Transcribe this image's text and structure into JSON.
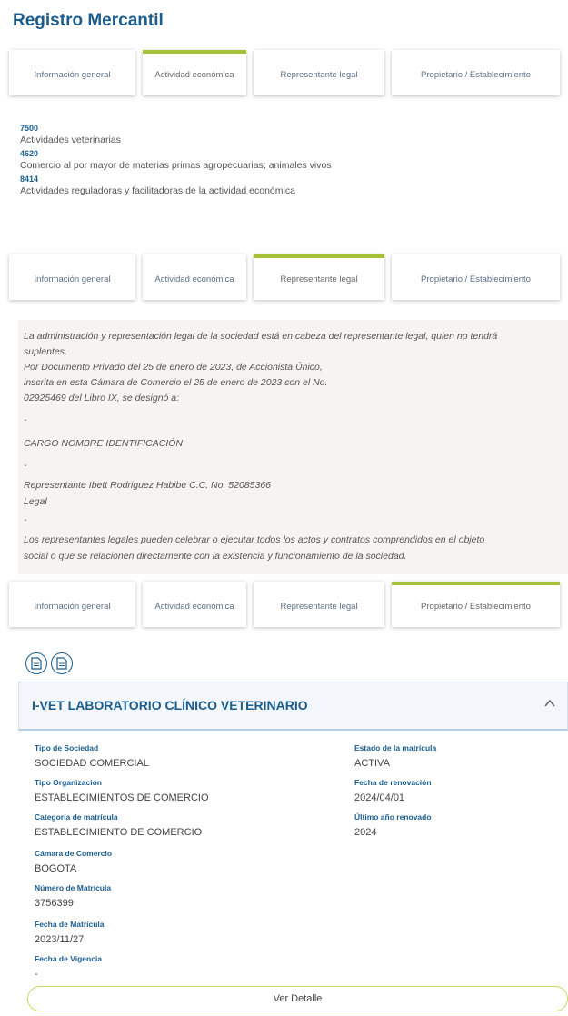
{
  "page": {
    "title": "Registro Mercantil"
  },
  "tabs": {
    "general": "Información general",
    "activity": "Actividad económica",
    "legal_rep": "Representante legal",
    "owner": "Propietario / Establecimiento"
  },
  "activities": [
    {
      "code": "7500",
      "description": "Actividades veterinarias"
    },
    {
      "code": "4620",
      "description": "Comercio al por mayor de materias primas agropecuarias; animales vivos"
    },
    {
      "code": "8414",
      "description": "Actividades reguladoras y facilitadoras de la actividad económica"
    }
  ],
  "representation": {
    "lines": [
      "La administración y representación legal de la sociedad está en cabeza del representante legal, quien no tendrá",
      "suplentes.",
      "Por  Documento  Privado  del 25 de enero de 2023, de Accionista Único,",
      "inscrita  en esta Cámara de Comercio el 25 de enero de 2023 con el No.",
      "02925469 del Libro IX, se designó a:",
      "-",
      "CARGO          NOMBRE                    IDENTIFICACIÓN",
      "-",
      "Representante    Ibett Rodriguez Habibe    C.C. No. 52085366",
      "Legal",
      "-",
      "Los representantes legales pueden celebrar o ejecutar todos los actos y contratos comprendidos en el objeto",
      "social o que se relacionen directamente con la existencia y funcionamiento de la sociedad."
    ]
  },
  "establishment": {
    "name": "I-VET LABORATORIO CLÍNICO VETERINARIO",
    "left_fields": [
      {
        "label": "Tipo de Sociedad",
        "value": "SOCIEDAD COMERCIAL"
      },
      {
        "label": "Tipo Organización",
        "value": "ESTABLECIMIENTOS DE COMERCIO"
      },
      {
        "label": "Categoría de matrícula",
        "value": "ESTABLECIMIENTO DE COMERCIO"
      },
      {
        "label": "Cámara de Comercio",
        "value": "BOGOTA"
      },
      {
        "label": "Número de Matrícula",
        "value": "3756399"
      },
      {
        "label": "Fecha de Matrícula",
        "value": "2023/11/27"
      },
      {
        "label": "Fecha de Vigencia",
        "value": "-"
      }
    ],
    "right_fields": [
      {
        "label": "Estado de la matrícula",
        "value": "ACTIVA"
      },
      {
        "label": "Fecha de renovación",
        "value": "2024/04/01"
      },
      {
        "label": "Último año renovado",
        "value": "2024"
      }
    ],
    "detail_button": "Ver Detalle"
  },
  "icons": {
    "doc1": "document-icon",
    "doc2": "document-icon",
    "collapse": "chevron-up-icon"
  },
  "colors": {
    "primary": "#1a5d8e",
    "accent": "#a6c23a"
  }
}
